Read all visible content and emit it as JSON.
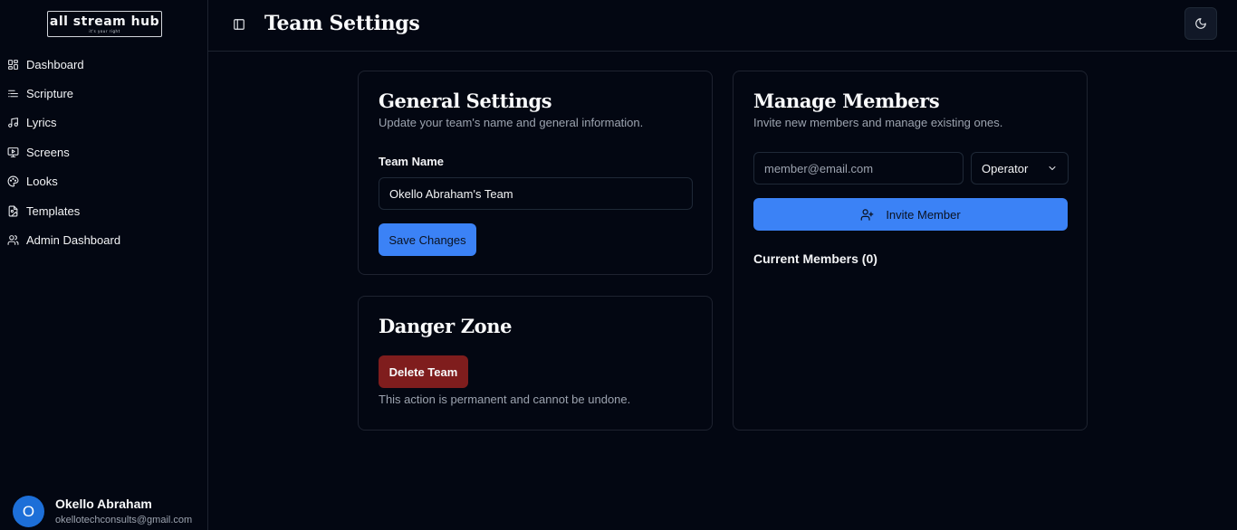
{
  "logo": {
    "main": "all stream hub",
    "tagline": "it's your right"
  },
  "sidebar": {
    "items": [
      {
        "label": "Dashboard",
        "icon": "layout-dashboard-icon"
      },
      {
        "label": "Scripture",
        "icon": "list-icon"
      },
      {
        "label": "Lyrics",
        "icon": "music-icon"
      },
      {
        "label": "Screens",
        "icon": "monitor-icon"
      },
      {
        "label": "Looks",
        "icon": "palette-icon"
      },
      {
        "label": "Templates",
        "icon": "file-image-icon"
      },
      {
        "label": "Admin Dashboard",
        "icon": "users-icon"
      }
    ]
  },
  "user": {
    "initial": "O",
    "name": "Okello Abraham",
    "email": "okellotechconsults@gmail.com"
  },
  "header": {
    "title": "Team Settings"
  },
  "general": {
    "title": "General Settings",
    "subtitle": "Update your team's name and general information.",
    "team_name_label": "Team Name",
    "team_name_value": "Okello Abraham's Team",
    "save_label": "Save Changes"
  },
  "danger": {
    "title": "Danger Zone",
    "delete_label": "Delete Team",
    "note": "This action is permanent and cannot be undone."
  },
  "members": {
    "title": "Manage Members",
    "subtitle": "Invite new members and manage existing ones.",
    "email_placeholder": "member@email.com",
    "role_selected": "Operator",
    "invite_label": "Invite Member",
    "current_label": "Current Members (0)"
  },
  "colors": {
    "background": "#030712",
    "primary": "#3b82f6",
    "danger": "#7f1d1d",
    "avatar": "#1d6fd8"
  }
}
